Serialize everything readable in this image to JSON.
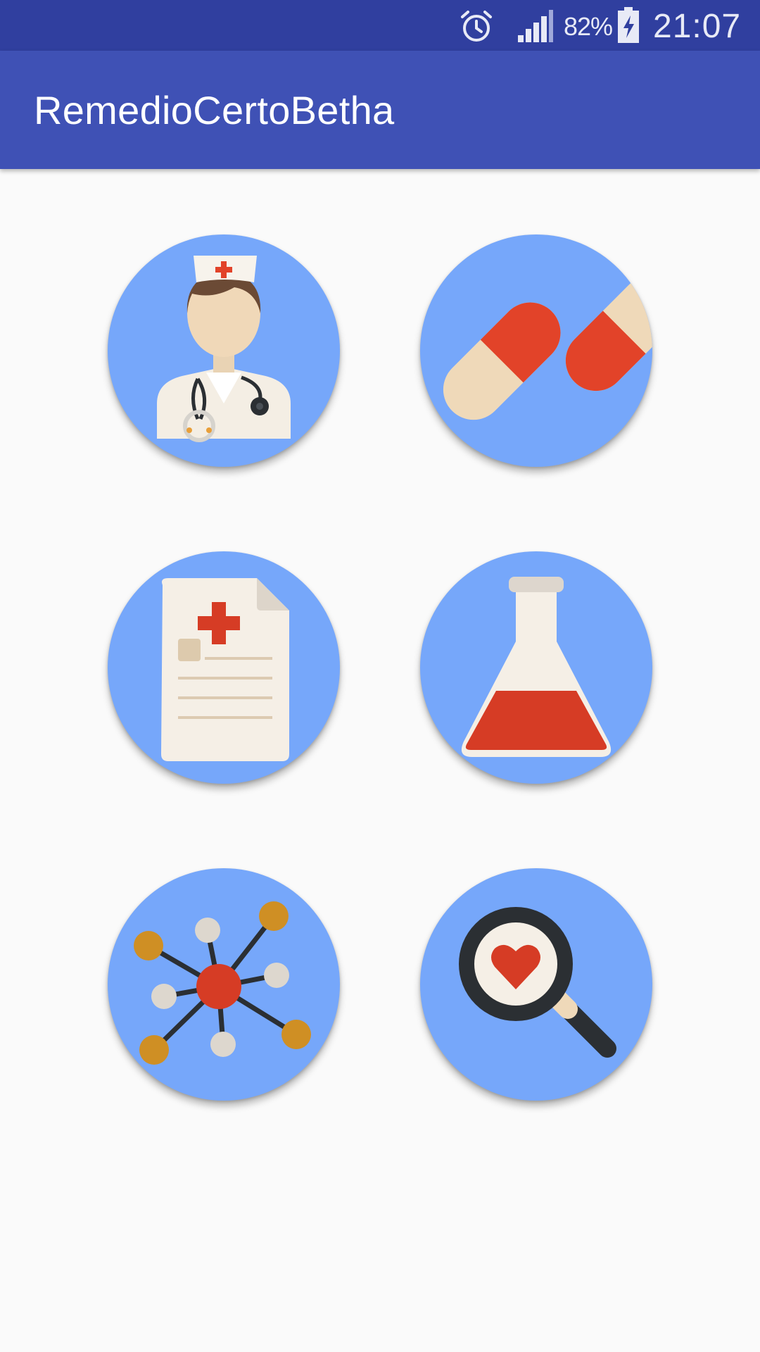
{
  "status_bar": {
    "battery_percent": "82%",
    "time": "21:07",
    "icons": [
      "alarm-icon",
      "signal-icon",
      "battery-charging-icon"
    ]
  },
  "app_bar": {
    "title": "RemedioCertoBetha"
  },
  "colors": {
    "status_bar": "#303f9f",
    "app_bar": "#3f51b5",
    "tile": "#76a7fa",
    "background": "#fafafa",
    "accent_red": "#e24329"
  },
  "menu_tiles": [
    {
      "icon": "nurse-doctor-icon"
    },
    {
      "icon": "pills-icon"
    },
    {
      "icon": "prescription-document-icon"
    },
    {
      "icon": "lab-flask-icon"
    },
    {
      "icon": "molecule-network-icon"
    },
    {
      "icon": "magnifier-heart-icon"
    }
  ]
}
